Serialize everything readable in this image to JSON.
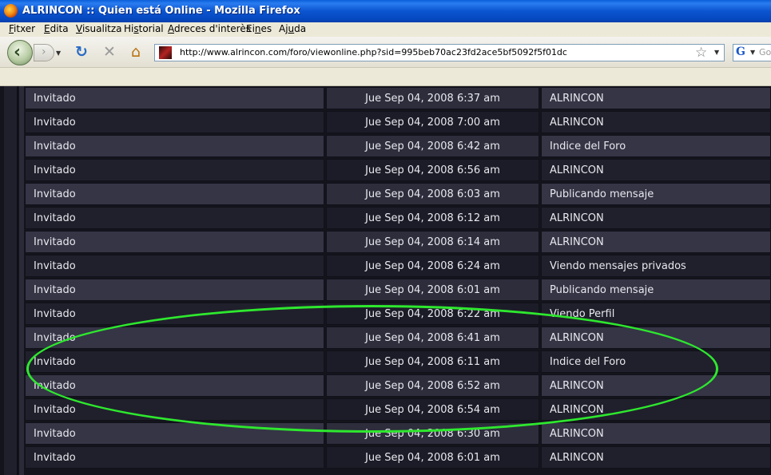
{
  "window": {
    "title": "ALRINCON :: Quien está Online - Mozilla Firefox"
  },
  "menu": [
    {
      "pre": "",
      "u": "F",
      "post": "itxer"
    },
    {
      "pre": "",
      "u": "E",
      "post": "dita"
    },
    {
      "pre": "",
      "u": "V",
      "post": "isualitza"
    },
    {
      "pre": "Hi",
      "u": "s",
      "post": "torial"
    },
    {
      "pre": "",
      "u": "A",
      "post": "dreces d'interès"
    },
    {
      "pre": "Ei",
      "u": "n",
      "post": "es"
    },
    {
      "pre": "Aj",
      "u": "u",
      "post": "da"
    }
  ],
  "nav": {
    "url": "http://www.alrincon.com/foro/viewonline.php?sid=995beb70ac23fd2ace5bf5092f5f01dc",
    "search_placeholder": "Go"
  },
  "rows": [
    {
      "user": "Invitado",
      "time": "Jue Sep 04, 2008 6:37 am",
      "location": "ALRINCON"
    },
    {
      "user": "Invitado",
      "time": "Jue Sep 04, 2008 7:00 am",
      "location": "ALRINCON"
    },
    {
      "user": "Invitado",
      "time": "Jue Sep 04, 2008 6:42 am",
      "location": "Indice del Foro"
    },
    {
      "user": "Invitado",
      "time": "Jue Sep 04, 2008 6:56 am",
      "location": "ALRINCON"
    },
    {
      "user": "Invitado",
      "time": "Jue Sep 04, 2008 6:03 am",
      "location": "Publicando mensaje"
    },
    {
      "user": "Invitado",
      "time": "Jue Sep 04, 2008 6:12 am",
      "location": "ALRINCON"
    },
    {
      "user": "Invitado",
      "time": "Jue Sep 04, 2008 6:14 am",
      "location": "ALRINCON"
    },
    {
      "user": "Invitado",
      "time": "Jue Sep 04, 2008 6:24 am",
      "location": "Viendo mensajes privados"
    },
    {
      "user": "Invitado",
      "time": "Jue Sep 04, 2008 6:01 am",
      "location": "Publicando mensaje"
    },
    {
      "user": "Invitado",
      "time": "Jue Sep 04, 2008 6:22 am",
      "location": "Viendo Perfil"
    },
    {
      "user": "Invitado",
      "time": "Jue Sep 04, 2008 6:41 am",
      "location": "ALRINCON"
    },
    {
      "user": "Invitado",
      "time": "Jue Sep 04, 2008 6:11 am",
      "location": "Indice del Foro"
    },
    {
      "user": "Invitado",
      "time": "Jue Sep 04, 2008 6:52 am",
      "location": "ALRINCON"
    },
    {
      "user": "Invitado",
      "time": "Jue Sep 04, 2008 6:54 am",
      "location": "ALRINCON"
    },
    {
      "user": "Invitado",
      "time": "Jue Sep 04, 2008 6:30 am",
      "location": "ALRINCON"
    },
    {
      "user": "Invitado",
      "time": "Jue Sep 04, 2008 6:01 am",
      "location": "ALRINCON"
    }
  ],
  "colors": {
    "highlight": "#2ee82e",
    "row_odd": "#353546",
    "row_even": "#20202c"
  },
  "icons": [
    "firefox-icon",
    "back-icon",
    "forward-icon",
    "reload-icon",
    "stop-icon",
    "home-icon",
    "favicon",
    "bookmark-star-icon",
    "google-icon"
  ]
}
